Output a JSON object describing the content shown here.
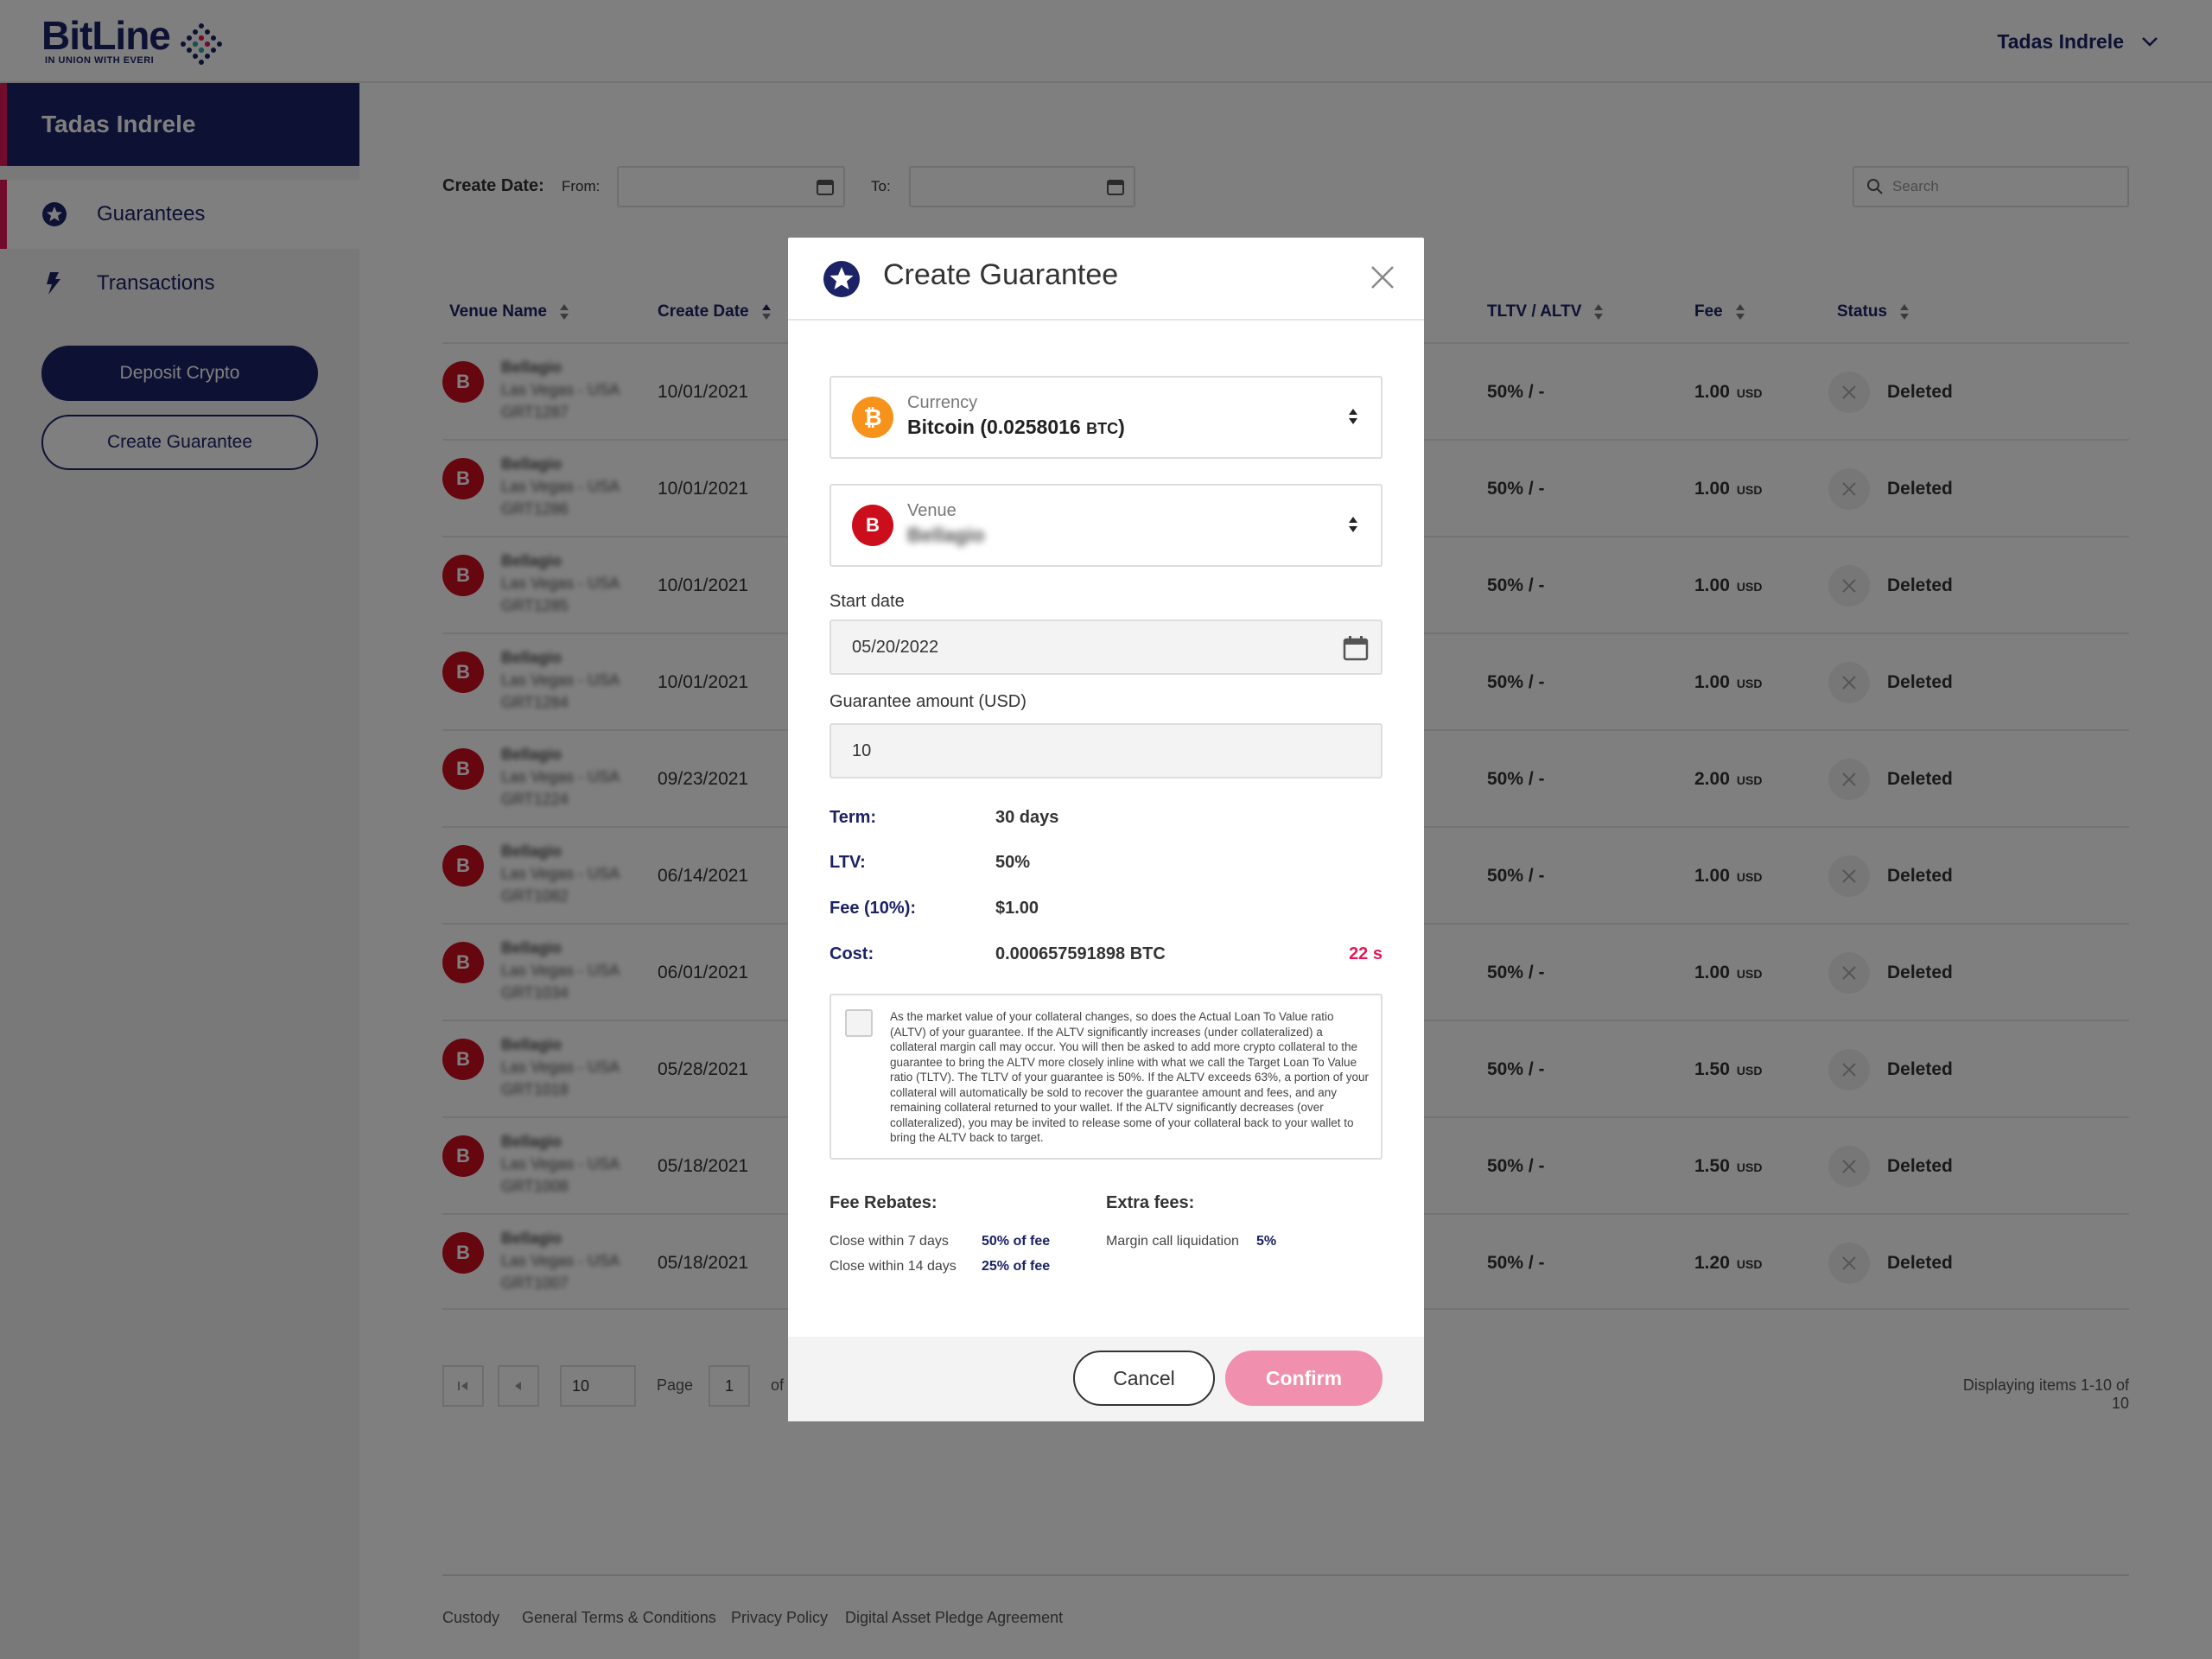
{
  "header": {
    "logo_text": "BitLine",
    "logo_sub": "IN UNION WITH EVERI",
    "user_name": "Tadas Indrele"
  },
  "sidebar": {
    "user_name": "Tadas Indrele",
    "items": [
      {
        "label": "Guarantees",
        "icon": "star-icon"
      },
      {
        "label": "Transactions",
        "icon": "transactions-icon"
      }
    ],
    "deposit_label": "Deposit Crypto",
    "create_label": "Create Guarantee"
  },
  "filters": {
    "create_date_label": "Create Date:",
    "from_label": "From:",
    "to_label": "To:",
    "search_placeholder": "Search"
  },
  "table": {
    "headers": [
      "Venue Name",
      "Create Date",
      "TLTV / ALTV",
      "Fee",
      "Status"
    ],
    "rows": [
      {
        "avatar": "B",
        "venue": "Bellagio",
        "location": "Las Vegas - USA",
        "ref": "GRT1287",
        "date": "10/01/2021",
        "tltv": "50% / -",
        "fee": "1.00",
        "unit": "USD",
        "status": "Deleted"
      },
      {
        "avatar": "B",
        "venue": "Bellagio",
        "location": "Las Vegas - USA",
        "ref": "GRT1286",
        "date": "10/01/2021",
        "tltv": "50% / -",
        "fee": "1.00",
        "unit": "USD",
        "status": "Deleted"
      },
      {
        "avatar": "B",
        "venue": "Bellagio",
        "location": "Las Vegas - USA",
        "ref": "GRT1285",
        "date": "10/01/2021",
        "tltv": "50% / -",
        "fee": "1.00",
        "unit": "USD",
        "status": "Deleted"
      },
      {
        "avatar": "B",
        "venue": "Bellagio",
        "location": "Las Vegas - USA",
        "ref": "GRT1284",
        "date": "10/01/2021",
        "tltv": "50% / -",
        "fee": "1.00",
        "unit": "USD",
        "status": "Deleted"
      },
      {
        "avatar": "B",
        "venue": "Bellagio",
        "location": "Las Vegas - USA",
        "ref": "GRT1224",
        "date": "09/23/2021",
        "tltv": "50% / -",
        "fee": "2.00",
        "unit": "USD",
        "status": "Deleted"
      },
      {
        "avatar": "B",
        "venue": "Bellagio",
        "location": "Las Vegas - USA",
        "ref": "GRT1082",
        "date": "06/14/2021",
        "tltv": "50% / -",
        "fee": "1.00",
        "unit": "USD",
        "status": "Deleted"
      },
      {
        "avatar": "B",
        "venue": "Bellagio",
        "location": "Las Vegas - USA",
        "ref": "GRT1034",
        "date": "06/01/2021",
        "tltv": "50% / -",
        "fee": "1.00",
        "unit": "USD",
        "status": "Deleted"
      },
      {
        "avatar": "B",
        "venue": "Bellagio",
        "location": "Las Vegas - USA",
        "ref": "GRT1018",
        "date": "05/28/2021",
        "tltv": "50% / -",
        "fee": "1.50",
        "unit": "USD",
        "status": "Deleted"
      },
      {
        "avatar": "B",
        "venue": "Bellagio",
        "location": "Las Vegas - USA",
        "ref": "GRT1008",
        "date": "05/18/2021",
        "tltv": "50% / -",
        "fee": "1.50",
        "unit": "USD",
        "status": "Deleted"
      },
      {
        "avatar": "B",
        "venue": "Bellagio",
        "location": "Las Vegas - USA",
        "ref": "GRT1007",
        "date": "05/18/2021",
        "tltv": "50% / -",
        "fee": "1.20",
        "unit": "USD",
        "status": "Deleted"
      }
    ]
  },
  "pagination": {
    "page_size": "10",
    "page_label": "Page",
    "page_number": "1",
    "of_label": "of",
    "summary": "Displaying items 1-10 of 10"
  },
  "footer": {
    "links": [
      "Custody",
      "General Terms & Conditions",
      "Privacy Policy",
      "Digital Asset Pledge Agreement"
    ]
  },
  "modal": {
    "title": "Create Guarantee",
    "currency": {
      "label": "Currency",
      "value": "Bitcoin (0.0258016 ",
      "unit": "BTC",
      "close": ")",
      "icon": "bitcoin-icon",
      "color": "#f7931a"
    },
    "venue": {
      "label": "Venue",
      "value": "Bellagio",
      "avatar": "B",
      "color": "#cc0d1c"
    },
    "start_date_label": "Start date",
    "start_date_value": "05/20/2022",
    "amount_label": "Guarantee amount (USD)",
    "amount_value": "10",
    "term_label": "Term:",
    "term_value": "30 days",
    "ltv_label": "LTV:",
    "ltv_value": "50%",
    "fee_label": "Fee (10%):",
    "fee_value": "$1.00",
    "cost_label": "Cost:",
    "cost_value": "0.000657591898 BTC",
    "timer": "22 s",
    "terms_text": "As the market value of your collateral changes, so does the Actual Loan To Value ratio (ALTV) of your guarantee. If the ALTV significantly increases (under collateralized) a collateral margin call may occur. You will then be asked to add more crypto collateral to the guarantee to bring the ALTV more closely inline with what we call the Target Loan To Value ratio (TLTV). The TLTV of your guarantee is 50%. If the ALTV exceeds 63%, a portion of your collateral will automatically be sold to recover the guarantee amount and fees, and any remaining collateral returned to your wallet. If the ALTV significantly decreases (over collateralized), you may be invited to release some of your collateral back to your wallet to bring the ALTV back to target.",
    "rebates_title": "Fee Rebates:",
    "rebates": [
      {
        "label": "Close within 7 days",
        "value": "50% of fee"
      },
      {
        "label": "Close within 14 days",
        "value": "25% of fee"
      }
    ],
    "extra_title": "Extra fees:",
    "extra": [
      {
        "label": "Margin call liquidation",
        "value": "5%"
      }
    ],
    "cancel_label": "Cancel",
    "confirm_label": "Confirm"
  },
  "colors": {
    "brand_navy": "#1b2266",
    "accent_pink": "#e5185a",
    "confirm_pink": "#f08fae",
    "venue_red": "#cc0d1c",
    "bitcoin_orange": "#f7931a"
  }
}
